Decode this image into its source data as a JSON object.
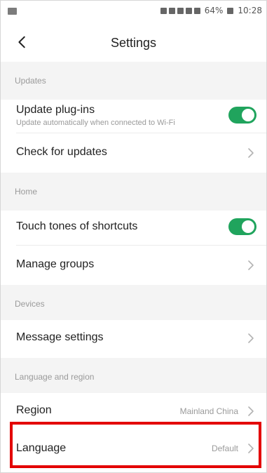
{
  "status_bar": {
    "battery": "64%",
    "time": "10:28"
  },
  "header": {
    "title": "Settings"
  },
  "sections": [
    {
      "name": "Updates"
    },
    {
      "name": "Home"
    },
    {
      "name": "Devices"
    },
    {
      "name": "Language and region"
    }
  ],
  "rows": {
    "update_plugins": {
      "label": "Update plug-ins",
      "sub": "Update automatically when connected to Wi-Fi",
      "toggle_on": true
    },
    "check_updates": {
      "label": "Check for updates"
    },
    "touch_tones": {
      "label": "Touch tones of shortcuts",
      "toggle_on": true
    },
    "manage_groups": {
      "label": "Manage groups"
    },
    "message_settings": {
      "label": "Message settings"
    },
    "region": {
      "label": "Region",
      "value": "Mainland China"
    },
    "language": {
      "label": "Language",
      "value": "Default"
    }
  },
  "colors": {
    "toggle_on": "#20a45d",
    "highlight": "#e30000"
  }
}
